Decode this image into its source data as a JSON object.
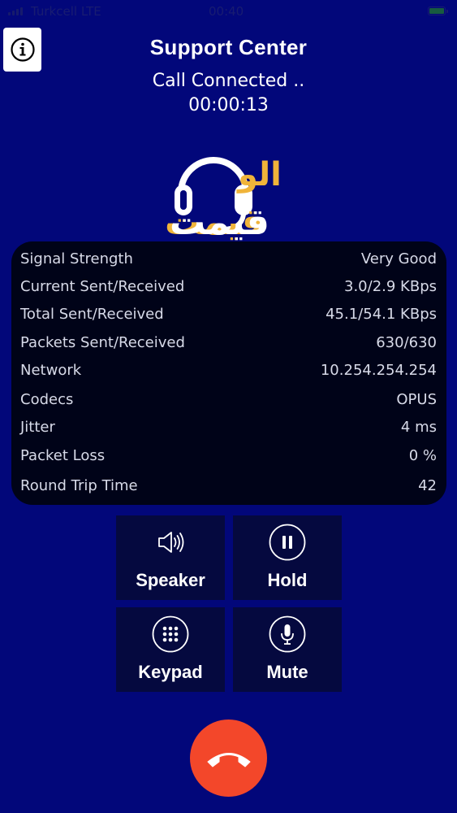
{
  "status_bar": {
    "carrier": "Turkcell  LTE",
    "time": "00:40"
  },
  "header": {
    "title": "Support Center",
    "call_status": "Call Connected ..",
    "timer": "00:00:13"
  },
  "logo": {
    "text_top": "الو",
    "text_bottom": "قيمت",
    "headset_icon": "headset-icon",
    "colors": {
      "primary": "#ffffff",
      "accent": "#f0b43a"
    }
  },
  "stats": [
    {
      "label": "Signal Strength",
      "value": "Very Good"
    },
    {
      "label": "Current Sent/Received",
      "value": "3.0/2.9 KBps"
    },
    {
      "label": "Total Sent/Received",
      "value": "45.1/54.1 KBps"
    },
    {
      "label": "Packets Sent/Received",
      "value": "630/630"
    },
    {
      "label": "Network",
      "value": "10.254.254.254"
    },
    {
      "label": "Codecs",
      "value": "OPUS"
    },
    {
      "label": "Jitter",
      "value": "4 ms"
    },
    {
      "label": "Packet Loss",
      "value": "0 %"
    },
    {
      "label": "Round Trip Time",
      "value": "42"
    }
  ],
  "controls": {
    "speaker": {
      "label": "Speaker",
      "icon": "speaker-icon"
    },
    "hold": {
      "label": "Hold",
      "icon": "pause-icon"
    },
    "keypad": {
      "label": "Keypad",
      "icon": "keypad-icon"
    },
    "mute": {
      "label": "Mute",
      "icon": "microphone-icon"
    }
  },
  "end_call": {
    "icon": "hangup-icon"
  },
  "colors": {
    "background": "#02077a",
    "panel": "#000318",
    "control_tile": "#05093f",
    "hangup": "#f3472a",
    "logo_accent": "#f0b43a"
  }
}
